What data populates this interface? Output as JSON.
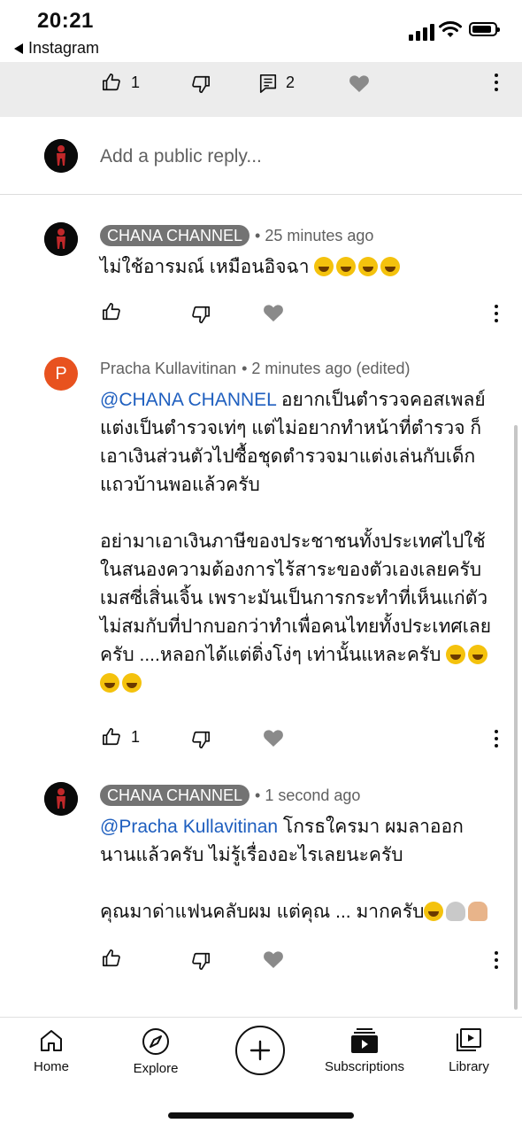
{
  "status_bar": {
    "time": "20:21",
    "back_app": "Instagram"
  },
  "top_actions": {
    "likes": "1",
    "replies": "2"
  },
  "reply_box": {
    "placeholder": "Add a public reply..."
  },
  "comments": [
    {
      "author": "CHANA CHANNEL",
      "author_chip": true,
      "time": "• 25 minutes ago",
      "text": "ไม่ใช้อารมณ์ เหมือนอิจฉา",
      "emoji_count": 4,
      "likes": ""
    },
    {
      "author": "Pracha Kullavitinan",
      "avatar_letter": "P",
      "time": "• 2 minutes ago (edited)",
      "mention": "@CHANA CHANNEL",
      "text_line1_rest": " อยากเป็นตำรวจคอสเพลย์",
      "text_lines": [
        "แต่งเป็นตำรวจเท่ๆ แต่ไม่อยากทำหน้าที่ตำรวจ ก็",
        "เอาเงินส่วนตัวไปซื้อชุดตำรวจมาแต่งเล่นกับเด็ก",
        "แถวบ้านพอแล้วครับ",
        "",
        "อย่ามาเอาเงินภาษีของประชาชนทั้งประเทศไปใช้",
        "ในสนองความต้องการไร้สาระของตัวเองเลยครับ",
        "เมสซี่เสิ่นเจิ้น เพราะมันเป็นการกระทำที่เห็นแก่ตัว",
        "ไม่สมกับที่ปากบอกว่าทำเพื่อคนไทยทั้งประเทศเลย",
        "ครับ ....หลอกได้แต่ติ่งโง่ๆ เท่านั้นแหละครับ"
      ],
      "likes": "1"
    },
    {
      "author": "CHANA CHANNEL",
      "author_chip": true,
      "time": "• 1 second ago",
      "mention": "@Pracha Kullavitinan",
      "text_line1_rest": " โกรธใครมา ผมลาออก",
      "text_lines": [
        "นานแล้วครับ ไม่รู้เรื่องอะไรเลยนะครับ",
        "",
        "คุณมาด่าแฟนคลับผม แต่คุณ ... มากครับ"
      ],
      "likes": ""
    }
  ],
  "bottom_nav": {
    "items": [
      {
        "label": "Home",
        "icon": "home-icon"
      },
      {
        "label": "Explore",
        "icon": "compass-icon"
      },
      {
        "label": "",
        "icon": "plus-icon"
      },
      {
        "label": "Subscriptions",
        "icon": "subscriptions-icon"
      },
      {
        "label": "Library",
        "icon": "library-icon"
      }
    ]
  },
  "colors": {
    "accent_link": "#1f5fbf",
    "chip_bg": "#737373",
    "avatar_p": "#e8521f",
    "strip_bg": "#ececec"
  }
}
